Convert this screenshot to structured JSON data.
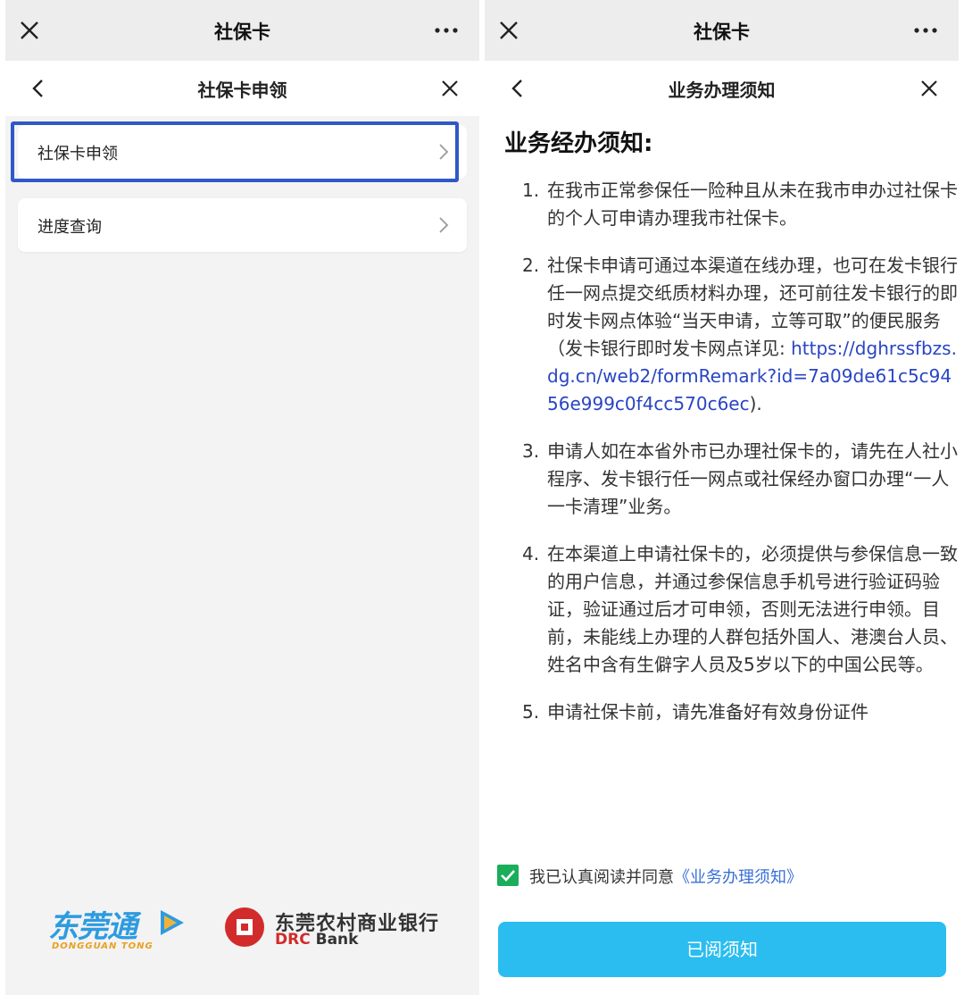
{
  "left_panel": {
    "window_title": "社保卡",
    "page_title": "社保卡申领",
    "menu": [
      {
        "label": "社保卡申领"
      },
      {
        "label": "进度查询"
      }
    ],
    "logos": {
      "dgt_name": "东莞通",
      "dgt_sub": "DONGGUAN TONG",
      "drc_cn": "东莞农村商业银行",
      "drc_en_red": "DRC",
      "drc_en_dark": " Bank"
    }
  },
  "right_panel": {
    "window_title": "社保卡",
    "page_title": "业务办理须知",
    "heading": "业务经办须知:",
    "items": [
      {
        "num": "1.",
        "text": "在我市正常参保任一险种且从未在我市申办过社保卡的个人可申请办理我市社保卡。"
      },
      {
        "num": "2.",
        "text": "社保卡申请可通过本渠道在线办理，也可在发卡银行任一网点提交纸质材料办理，还可前往发卡银行的即时发卡网点体验“当天申请，立等可取”的便民服务（发卡银行即时发卡网点详见:",
        "link": "https://dghrssfbzs.dg.cn/web2/formRemark?id=7a09de61c5c9456e999c0f4cc570c6ec",
        "tail": ")."
      },
      {
        "num": "3.",
        "text": "申请人如在本省外市已办理社保卡的，请先在人社小程序、发卡银行任一网点或社保经办窗口办理“一人一卡清理”业务。"
      },
      {
        "num": "4.",
        "text": "在本渠道上申请社保卡的，必须提供与参保信息一致的用户信息，并通过参保信息手机号进行验证码验证，验证通过后才可申领，否则无法进行申领。目前，未能线上办理的人群包括外国人、港澳台人员、姓名中含有生僻字人员及5岁以下的中国公民等。"
      },
      {
        "num": "5.",
        "text": "申请社保卡前，请先准备好有效身份证件"
      }
    ],
    "agree_text": "我已认真阅读并同意",
    "agree_link": "《业务办理须知》",
    "confirm_button": "已阅须知"
  },
  "colors": {
    "highlight_border": "#2e59c6",
    "link": "#2945c4",
    "checkbox": "#1aad5a",
    "confirm_button": "#2bbdf0"
  }
}
